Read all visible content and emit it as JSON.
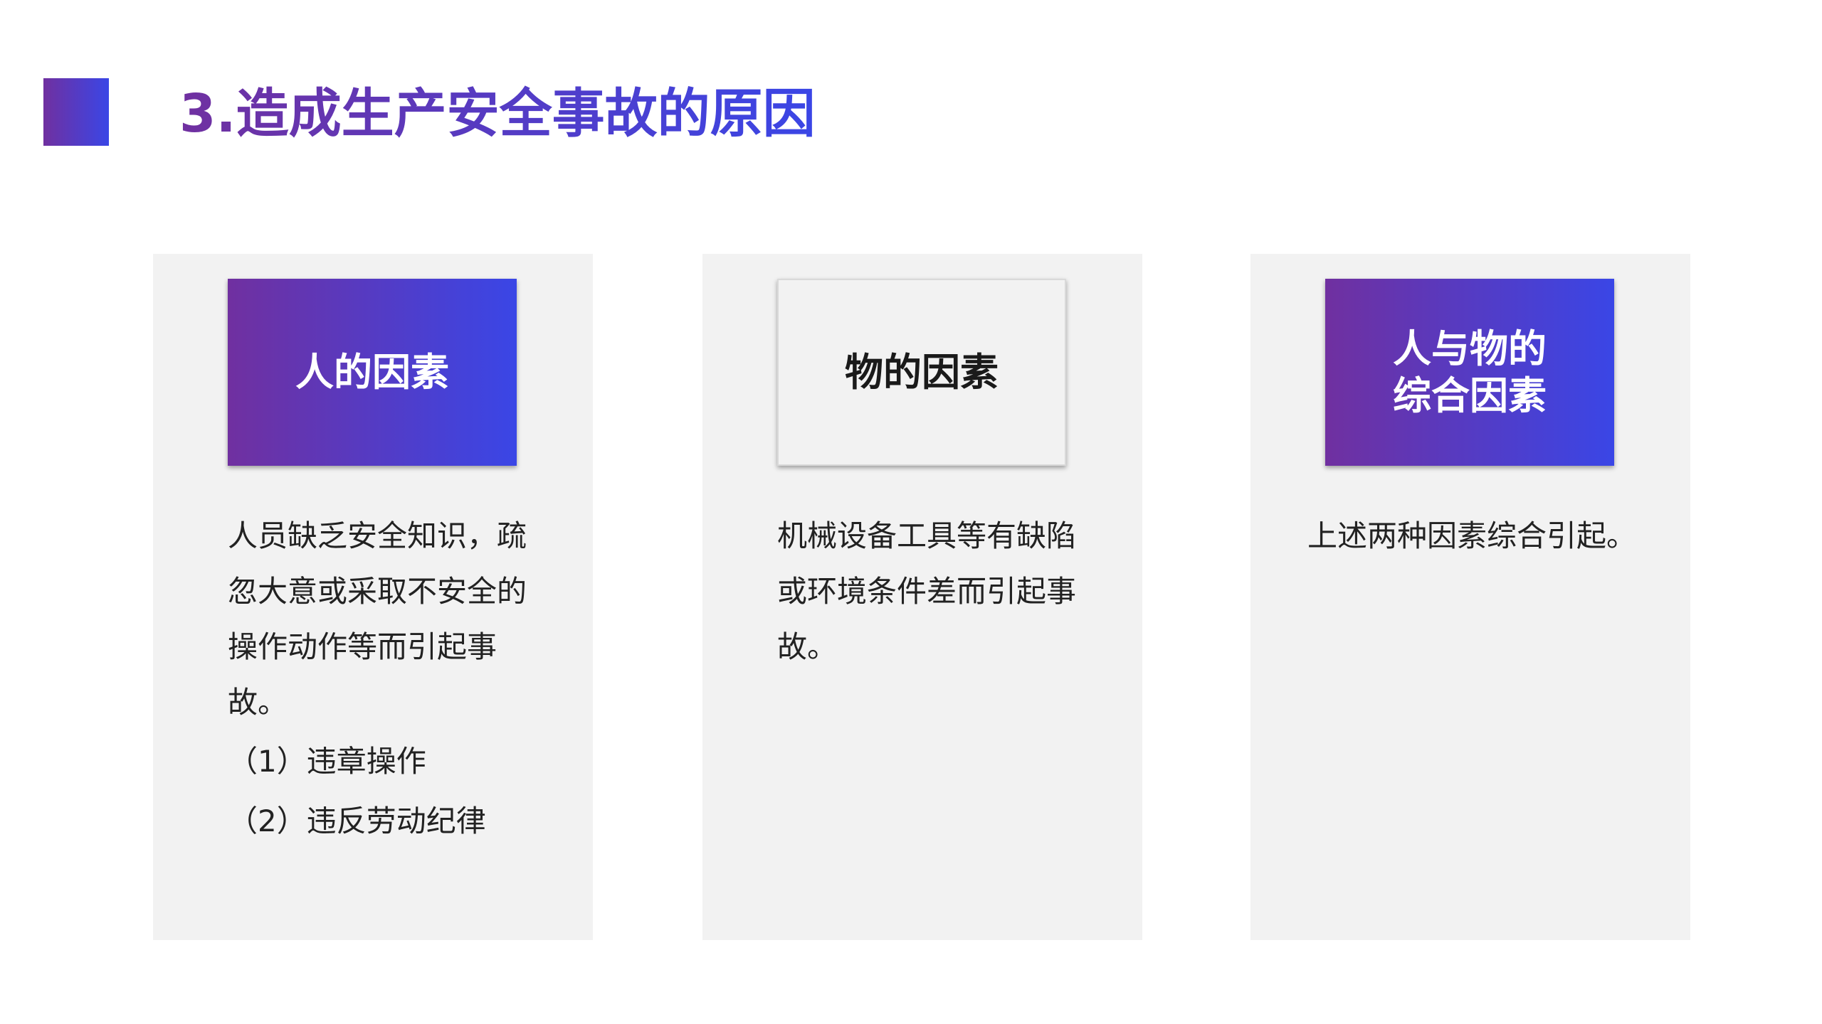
{
  "page": {
    "title": "3.造成生产安全事故的原因"
  },
  "colors": {
    "gradient_start": "#7030a0",
    "gradient_end": "#3a46e6",
    "card_bg": "#f2f2f2",
    "text": "#222222"
  },
  "cards": [
    {
      "heading": "人的因素",
      "body": "人员缺乏安全知识，疏忽大意或采取不安全的操作动作等而引起事故。",
      "items": [
        "（1）违章操作",
        "（2）违反劳动纪律"
      ]
    },
    {
      "heading": "物的因素",
      "body": "机械设备工具等有缺陷或环境条件差而引起事故。"
    },
    {
      "heading": "人与物的\n综合因素",
      "body": "上述两种因素综合引起。"
    }
  ]
}
